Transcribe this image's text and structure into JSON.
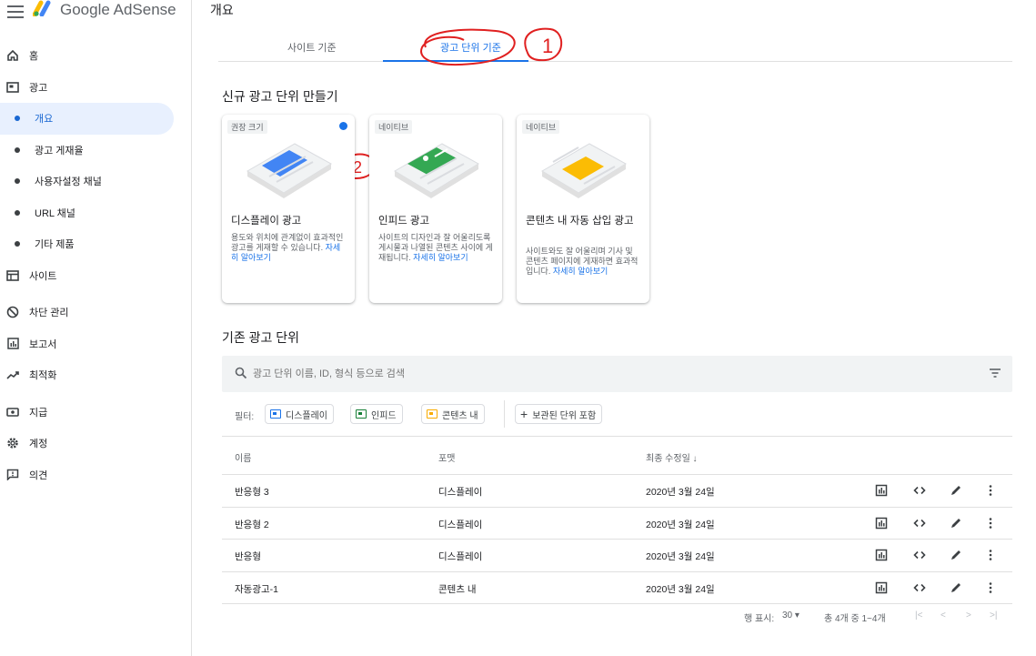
{
  "app": {
    "brand": "Google AdSense",
    "page_title": "개요"
  },
  "sidebar": {
    "items": [
      {
        "label": "홈",
        "icon": "home-icon"
      },
      {
        "label": "광고",
        "icon": "ads-icon"
      },
      {
        "label": "개요",
        "sub": true,
        "active": true
      },
      {
        "label": "광고 게재율",
        "sub": true
      },
      {
        "label": "사용자설정 채널",
        "sub": true
      },
      {
        "label": "URL 채널",
        "sub": true
      },
      {
        "label": "기타 제품",
        "sub": true
      },
      {
        "label": "사이트",
        "icon": "site-icon"
      },
      {
        "label": "차단 관리",
        "icon": "block-icon"
      },
      {
        "label": "보고서",
        "icon": "report-icon"
      },
      {
        "label": "최적화",
        "icon": "trend-icon"
      },
      {
        "label": "지급",
        "icon": "payment-icon"
      },
      {
        "label": "계정",
        "icon": "gear-icon"
      },
      {
        "label": "의견",
        "icon": "feedback-icon"
      }
    ]
  },
  "tabs": [
    {
      "label": "사이트 기준"
    },
    {
      "label": "광고 단위 기준",
      "active": true
    }
  ],
  "new_section": {
    "title": "신규 광고 단위 만들기"
  },
  "cards": [
    {
      "tag": "권장 크기",
      "title": "디스플레이 광고",
      "desc": "용도와 위치에 관계없이 효과적인 광고를 게재할 수 있습니다.",
      "link": "자세히 알아보기",
      "accent": "#4285f4"
    },
    {
      "tag": "네이티브",
      "title": "인피드 광고",
      "desc": "사이트의 디자인과 잘 어울리도록 게시물과 나열된 콘텐츠 사이에 게재됩니다.",
      "link": "자세히 알아보기",
      "accent": "#34a853"
    },
    {
      "tag": "네이티브",
      "title": "콘텐츠 내 자동 삽입 광고",
      "desc": "사이트와도 잘 어울리며 기사 및 콘텐츠 페이지에 게재하면 효과적입니다.",
      "link": "자세히 알아보기",
      "accent": "#fbbc04"
    }
  ],
  "existing_section": {
    "title": "기존 광고 단위"
  },
  "search": {
    "placeholder": "광고 단위 이름, ID, 형식 등으로 검색"
  },
  "filters": {
    "label": "필터:",
    "chips": [
      {
        "label": "디스플레이",
        "color": "#1a73e8"
      },
      {
        "label": "인피드",
        "color": "#188038"
      },
      {
        "label": "콘텐츠 내",
        "color": "#f9ab00"
      }
    ],
    "add_label": "보관된 단위 포함"
  },
  "table": {
    "headers": {
      "name": "이름",
      "format": "포맷",
      "modified": "최종 수정일 ↓"
    },
    "rows": [
      {
        "name": "반응형 3",
        "format": "디스플레이",
        "modified": "2020년 3월 24일"
      },
      {
        "name": "반응형 2",
        "format": "디스플레이",
        "modified": "2020년 3월 24일"
      },
      {
        "name": "반응형",
        "format": "디스플레이",
        "modified": "2020년 3월 24일"
      },
      {
        "name": "자동광고-1",
        "format": "콘텐츠 내",
        "modified": "2020년 3월 24일"
      }
    ]
  },
  "pager": {
    "rows_label": "행 표시:",
    "rows_value": "30 ▾",
    "range": "총 4개 중 1~4개"
  },
  "annotations": {
    "one": "1",
    "two": "2"
  }
}
